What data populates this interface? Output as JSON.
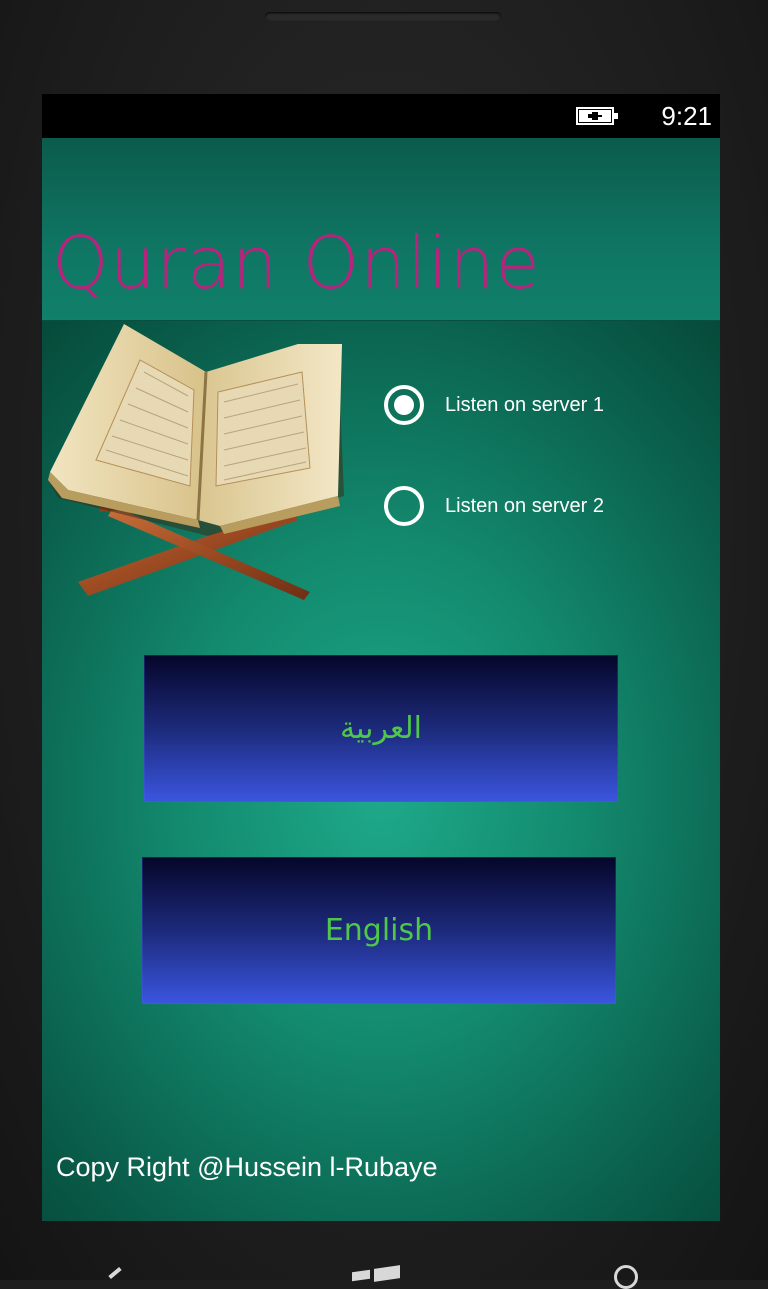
{
  "statusbar": {
    "time": "9:21",
    "battery_icon": "battery-charging-icon"
  },
  "header": {
    "title": "Quran Online",
    "title_color": "#b7237d"
  },
  "image": {
    "name": "quran-book-on-stand"
  },
  "servers": [
    {
      "label": "Listen on server 1",
      "checked": true
    },
    {
      "label": "Listen on server 2",
      "checked": false
    }
  ],
  "buttons": {
    "arabic_label": "العربية",
    "english_label": "English",
    "text_color": "#4fc84a"
  },
  "footer": {
    "copyright": "Copy Right @Hussein l-Rubaye"
  },
  "colors": {
    "screen_background": "#138a6e",
    "button_gradient_top": "#06062a",
    "button_gradient_bottom": "#3b55e0"
  }
}
